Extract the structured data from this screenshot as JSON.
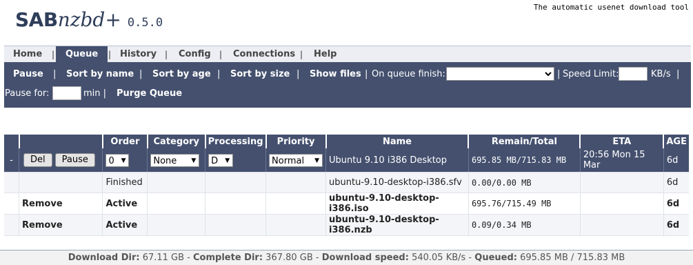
{
  "header": {
    "tagline": "The automatic usenet download tool",
    "logo_sab": "SAB",
    "logo_nzbd": "nzbd+",
    "version": "0.5.0"
  },
  "nav": {
    "tabs": [
      "Home",
      "Queue",
      "History",
      "Config",
      "Connections",
      "Help"
    ],
    "active": "Queue",
    "separator": "|"
  },
  "toolbar": {
    "pause": "Pause",
    "sort_name": "Sort by name",
    "sort_age": "Sort by age",
    "sort_size": "Sort by size",
    "show_files": "Show files",
    "sep": "|",
    "on_queue_finish_label": "On queue finish:",
    "on_queue_finish_value": "",
    "speed_limit_label": "Speed Limit:",
    "speed_limit_value": "",
    "speed_unit": "KB/s",
    "pause_for_label": "Pause for:",
    "pause_for_value": "",
    "pause_for_unit": "min |",
    "purge": "Purge Queue"
  },
  "queue": {
    "columns": [
      "",
      "",
      "Order",
      "Category",
      "Processing",
      "Priority",
      "Name",
      "Remain/Total",
      "ETA",
      "AGE"
    ],
    "job": {
      "toggle": "-",
      "del_label": "Del",
      "pause_label": "Pause",
      "order": "0",
      "category": "None",
      "processing": "D",
      "priority": "Normal",
      "name": "Ubuntu 9.10 i386 Desktop",
      "remain_total": "695.85 MB/715.83 MB",
      "eta": "20:56 Mon 15 Mar",
      "age": "6d"
    },
    "files": [
      {
        "action": "",
        "status": "Finished",
        "name": "ubuntu-9.10-desktop-i386.sfv",
        "remain_total": "0.00/0.00 MB",
        "age": "6d",
        "bold": false
      },
      {
        "action": "Remove",
        "status": "Active",
        "name": "ubuntu-9.10-desktop-i386.iso",
        "remain_total": "695.76/715.49 MB",
        "age": "6d",
        "bold": true
      },
      {
        "action": "Remove",
        "status": "Active",
        "name": "ubuntu-9.10-desktop-i386.nzb",
        "remain_total": "0.09/0.34 MB",
        "age": "6d",
        "bold": true
      }
    ]
  },
  "footer": {
    "download_dir_label": "Download Dir:",
    "download_dir": "67.11 GB",
    "complete_dir_label": "Complete Dir:",
    "complete_dir": "367.80 GB",
    "speed_label": "Download speed:",
    "speed": "540.05 KB/s",
    "queued_label": "Queued:",
    "queued": "695.85 MB / 715.83 MB",
    "dash": " - "
  }
}
